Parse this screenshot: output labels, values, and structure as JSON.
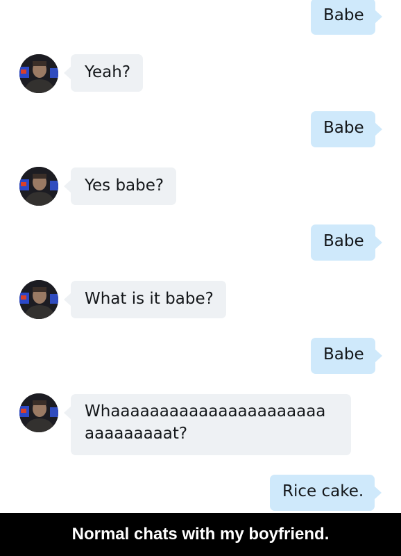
{
  "messages": [
    {
      "from": "me",
      "text": "Babe"
    },
    {
      "from": "them",
      "text": "Yeah?"
    },
    {
      "from": "me",
      "text": "Babe"
    },
    {
      "from": "them",
      "text": "Yes babe?"
    },
    {
      "from": "me",
      "text": "Babe"
    },
    {
      "from": "them",
      "text": "What is it babe?"
    },
    {
      "from": "me",
      "text": "Babe"
    },
    {
      "from": "them",
      "lines": [
        "Whaaaaaaaaaaaaaaaaaaaaaa",
        "aaaaaaaaat?"
      ]
    },
    {
      "from": "me",
      "text": "Rice cake."
    }
  ],
  "caption": "Normal chats with my boyfriend.",
  "colors": {
    "sent_bubble": "#cfe9fb",
    "received_bubble": "#eef1f4",
    "caption_bar": "#000000"
  }
}
